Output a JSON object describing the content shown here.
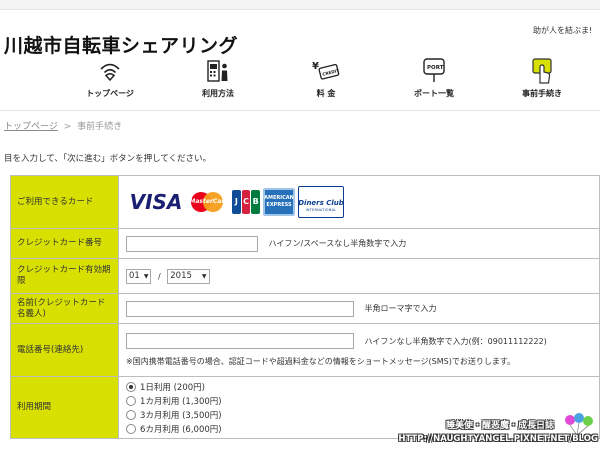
{
  "header": {
    "brand": "川越市自転車シェアリング",
    "tagline": "助が人を結ぶま!"
  },
  "nav": {
    "items": [
      {
        "label": "トップページ",
        "icon": "wifi-signal-icon"
      },
      {
        "label": "利用方法",
        "icon": "terminal-person-icon"
      },
      {
        "label": "料 金",
        "icon": "credit-yen-icon"
      },
      {
        "label": "ポート一覧",
        "icon": "port-sign-icon"
      },
      {
        "label": "事前手続き",
        "icon": "hand-card-icon",
        "active": true
      }
    ],
    "active_color": "#d7e000"
  },
  "breadcrumb": {
    "home": "トップページ",
    "separator": ">",
    "current": "事前手続き"
  },
  "instruction": "目を入力して、「次に進む」ボタンを押してください。",
  "form": {
    "label_bg": "#d7e000",
    "rows": {
      "cards": {
        "label": "ご利用できるカード",
        "brands": [
          "VISA",
          "MasterCard",
          "JCB",
          "AMERICAN EXPRESS",
          "Diners Club",
          "INTERNATIONAL"
        ]
      },
      "card_number": {
        "label": "クレジットカード番号",
        "value": "",
        "hint": "ハイフン/スペースなし半角数字で入力"
      },
      "expiry": {
        "label": "クレジットカード有効期限",
        "month": "01",
        "separator": "/",
        "year": "2015"
      },
      "name": {
        "label": "名前(クレジットカード名義人)",
        "value": "",
        "hint": "半角ローマ字で入力"
      },
      "phone": {
        "label": "電話番号(連絡先)",
        "value": "",
        "hint": "ハイフンなし半角数字で入力(例：09011112222)",
        "note": "※国内携帯電話番号の場合、認証コードや超過料金などの情報をショートメッセージ(SMS)でお送りします。"
      },
      "period": {
        "label": "利用期間",
        "options": [
          {
            "label": "1日利用 (200円)",
            "selected": true
          },
          {
            "label": "1カ月利用 (1,300円)",
            "selected": false
          },
          {
            "label": "3カ月利用 (3,500円)",
            "selected": false
          },
          {
            "label": "6カ月利用 (6,000円)",
            "selected": false
          }
        ]
      }
    }
  },
  "watermark": {
    "line1": "睡美使・醒恶魔・成長日誌",
    "line2": "HTTP://NAUGHTYANGEL.PIXNET.NET/BLOG"
  }
}
